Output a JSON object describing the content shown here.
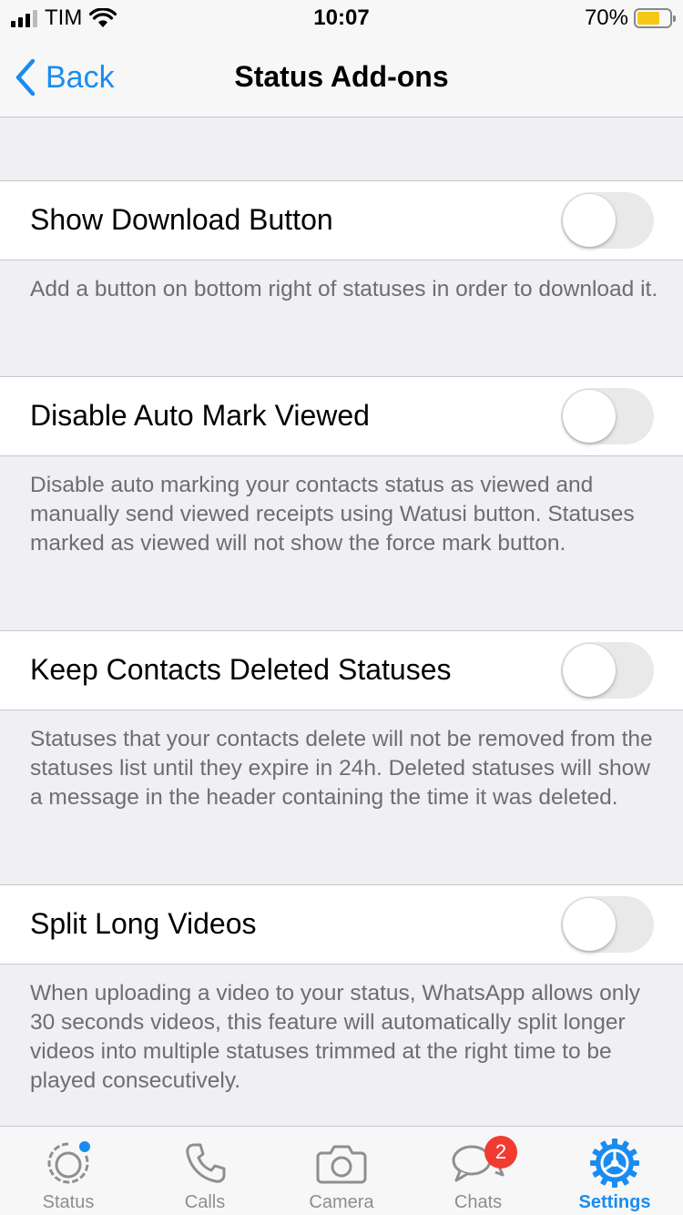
{
  "status_bar": {
    "carrier": "TIM",
    "time": "10:07",
    "battery_percent": "70%",
    "battery_level": 0.7
  },
  "nav": {
    "back_label": "Back",
    "title": "Status Add-ons"
  },
  "settings": [
    {
      "label": "Show Download Button",
      "enabled": false,
      "description": "Add a button on bottom right of statuses in order to download it."
    },
    {
      "label": "Disable Auto Mark Viewed",
      "enabled": false,
      "description": "Disable auto marking your contacts status as viewed and manually send viewed receipts using Watusi button. Statuses marked as viewed will not show the force mark button."
    },
    {
      "label": "Keep Contacts Deleted Statuses",
      "enabled": false,
      "description": "Statuses that your contacts delete will not be removed from the statuses list until they expire in 24h. Deleted statuses will show a message in the header containing the time it was deleted."
    },
    {
      "label": "Split Long Videos",
      "enabled": false,
      "description": "When uploading a video to your status, WhatsApp allows only 30 seconds videos, this feature will automatically split longer videos into multiple statuses trimmed at the right time to be played consecutively."
    }
  ],
  "tabs": [
    {
      "label": "Status",
      "icon": "status-icon"
    },
    {
      "label": "Calls",
      "icon": "phone-icon"
    },
    {
      "label": "Camera",
      "icon": "camera-icon"
    },
    {
      "label": "Chats",
      "icon": "chat-bubbles-icon",
      "badge": "2"
    },
    {
      "label": "Settings",
      "icon": "gear-icon",
      "active": true
    }
  ],
  "colors": {
    "accent": "#1a8cf0",
    "badge": "#f23b30",
    "battery": "#f6c816",
    "background": "#efeff4"
  }
}
